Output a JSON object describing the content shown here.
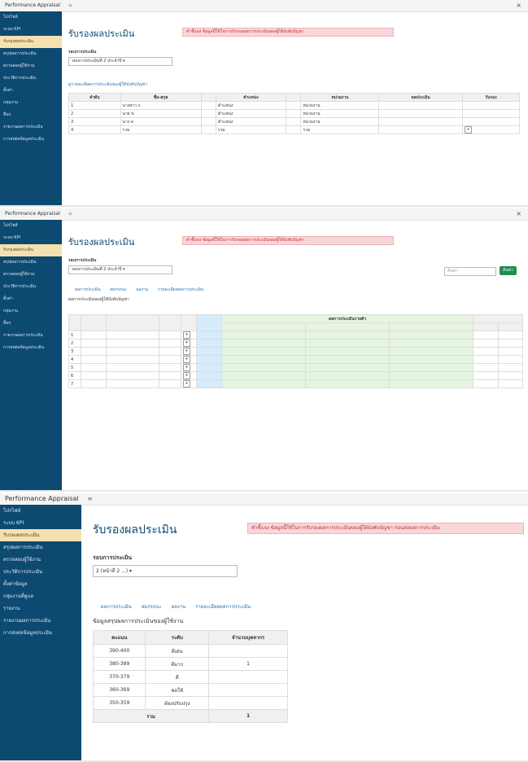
{
  "panel1": {
    "tab_label": "Performance Appraisal",
    "close_icon": "×",
    "sidebar": [
      "โปรไฟล์",
      "ระบบ KPI",
      "รับรองผลประเมิน",
      "สรุปผลการประเมิน",
      "ตรวจสอบผู้ใช้งาน",
      "ประวัติการประเมิน",
      "ตั้งค่า",
      "กลุ่มงาน",
      "อื่นๆ",
      "รายงานผลการประเมิน",
      "การส่งต่อข้อมูลประเมิน"
    ],
    "title": "รับรองผลประเมิน",
    "alert": "คำชี้แจง ข้อมูลนี้ใช้ในการรับรองผลการประเมินของผู้ใต้บังคับบัญชา",
    "label": "รอบการประเมิน",
    "select": "รอบการประเมินที่ 2 ประจำปี ▾",
    "link": "ดูรายละเอียดการประเมินของผู้ใต้บังคับบัญชา",
    "headers": [
      "ลำดับ",
      "ชื่อ-สกุล",
      "",
      "ตำแหน่ง",
      "",
      "หน่วยงาน",
      "ผลประเมิน",
      "รับรอง"
    ],
    "rows": [
      [
        "1",
        "นางสาว ก",
        "",
        "ตำแหน่ง",
        "",
        "หน่วยงาน",
        "",
        ""
      ],
      [
        "2",
        "นาย ข",
        "",
        "ตำแหน่ง",
        "",
        "หน่วยงาน",
        "",
        ""
      ],
      [
        "3",
        "นาง ค",
        "",
        "ตำแหน่ง",
        "",
        "หน่วยงาน",
        "",
        ""
      ],
      [
        "4",
        "รวม",
        "",
        "รวม",
        "",
        "รวม",
        "",
        ""
      ]
    ]
  },
  "panel2": {
    "tab_label": "Performance Appraisal",
    "title": "รับรองผลประเมิน",
    "alert": "คำชี้แจง ข้อมูลนี้ใช้ในการรับรองผลการประเมินของผู้ใต้บังคับบัญชา",
    "label": "รอบการประเมิน",
    "select": "รอบการประเมินที่ 2 ประจำปี ▾",
    "search_placeholder": "ค้นหา",
    "search_button": "ค้นหา",
    "tabs": [
      "ผลการประเมิน",
      "สมรรถนะ",
      "ผลงาน",
      "รายละเอียดผลการประเมิน"
    ],
    "summary": "ผลการประเมินของผู้ใต้บังคับบัญชา",
    "column_group": "ผลการประเมินรายตัว",
    "rows": [
      "1",
      "2",
      "3",
      "4",
      "5",
      "6",
      "7"
    ]
  },
  "panel3": {
    "tab_label": "Performance Appraisal",
    "sidebar": [
      "โปรไฟล์",
      "ระบบ KPI",
      "รับรองผลประเมิน",
      "สรุปผลการประเมิน",
      "ตรวจสอบผู้ใช้งาน",
      "ประวัติการประเมิน",
      "ตั้งค่าข้อมูล",
      "กลุ่มงานที่ดูแล",
      "รายงาน",
      "รายงานผลการประเมิน",
      "การส่งต่อข้อมูลประเมิน"
    ],
    "title": "รับรองผลประเมิน",
    "alert": "คำชี้แจง ข้อมูลนี้ใช้ในการรับรองผลการประเมินของผู้ใต้บังคับบัญชา ก่อนส่งผลการประเมิน",
    "label": "รอบการประเมิน",
    "select": "2 (หน้าที่ 2 ...) ▾",
    "tabs": [
      "ผลการประเมิน",
      "สมรรถนะ",
      "ผลงาน",
      "รายละเอียดผลการประเมิน"
    ],
    "subtitle": "ข้อมูลสรุปผลการประเมินของผู้ใช้งาน",
    "headers": [
      "คะแนน",
      "ระดับ",
      "จำนวนบุคลากร"
    ],
    "rows": [
      [
        "390-400",
        "ดีเด่น",
        ""
      ],
      [
        "380-389",
        "ดีมาก",
        "1"
      ],
      [
        "370-379",
        "ดี",
        ""
      ],
      [
        "360-369",
        "พอใช้",
        ""
      ],
      [
        "350-359",
        "ต้องปรับปรุง",
        ""
      ]
    ],
    "total_label": "รวม",
    "total_value": "1"
  }
}
